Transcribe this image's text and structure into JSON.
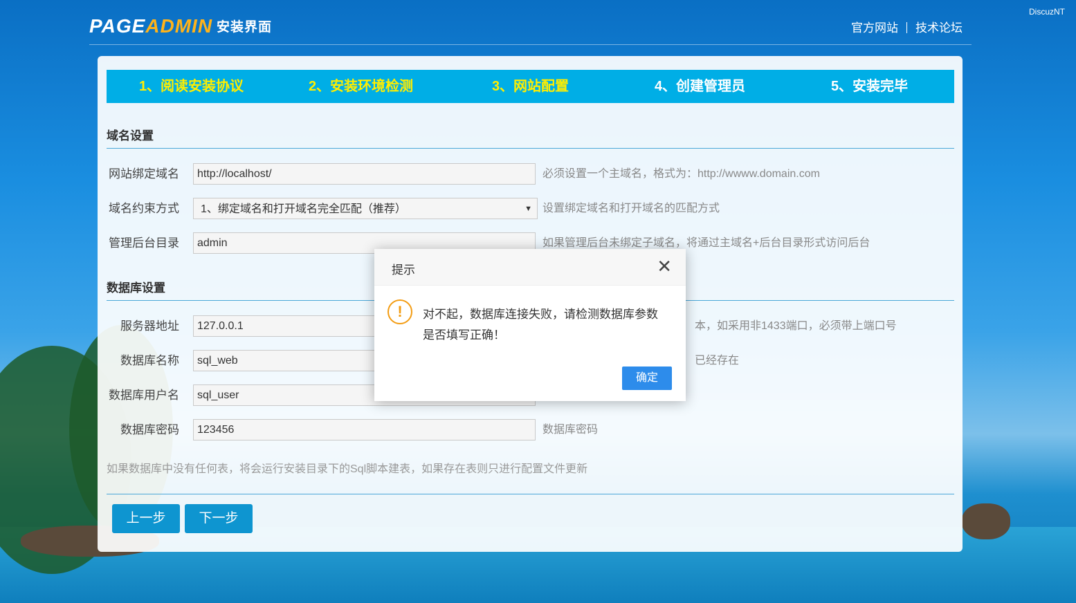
{
  "watermark": "DiscuzNT",
  "header": {
    "logo_part1": "PAGE",
    "logo_part2": "ADMIN",
    "logo_part3": "安装界面",
    "link_official": "官方网站",
    "link_forum": "技术论坛"
  },
  "steps": [
    {
      "label": "1、阅读安装协议"
    },
    {
      "label": "2、安装环境检测"
    },
    {
      "label": "3、网站配置"
    },
    {
      "label": "4、创建管理员"
    },
    {
      "label": "5、安装完毕"
    }
  ],
  "domain_section": {
    "title": "域名设置",
    "rows": [
      {
        "label": "网站绑定域名",
        "value": "http://localhost/",
        "hint": "必须设置一个主域名，格式为：http://wwww.domain.com"
      },
      {
        "label": "域名约束方式",
        "value": "1、绑定域名和打开域名完全匹配（推荐）",
        "hint": "设置绑定域名和打开域名的匹配方式"
      },
      {
        "label": "管理后台目录",
        "value": "admin",
        "hint": "如果管理后台未绑定子域名，将通过主域名+后台目录形式访问后台"
      }
    ]
  },
  "db_section": {
    "title": "数据库设置",
    "rows": [
      {
        "label": "服务器地址",
        "value": "127.0.0.1",
        "hint": "本，如采用非1433端口，必须带上端口号"
      },
      {
        "label": "数据库名称",
        "value": "sql_web",
        "hint": "已经存在"
      },
      {
        "label": "数据库用户名",
        "value": "sql_user",
        "hint": ""
      },
      {
        "label": "数据库密码",
        "value": "123456",
        "hint": "数据库密码"
      }
    ],
    "note": "如果数据库中没有任何表，将会运行安装目录下的Sql脚本建表，如果存在表则只进行配置文件更新"
  },
  "buttons": {
    "prev": "上一步",
    "next": "下一步"
  },
  "dialog": {
    "title": "提示",
    "close": "✕",
    "icon": "!",
    "message": "对不起，数据库连接失败，请检测数据库参数是否填写正确！",
    "ok": "确定"
  }
}
